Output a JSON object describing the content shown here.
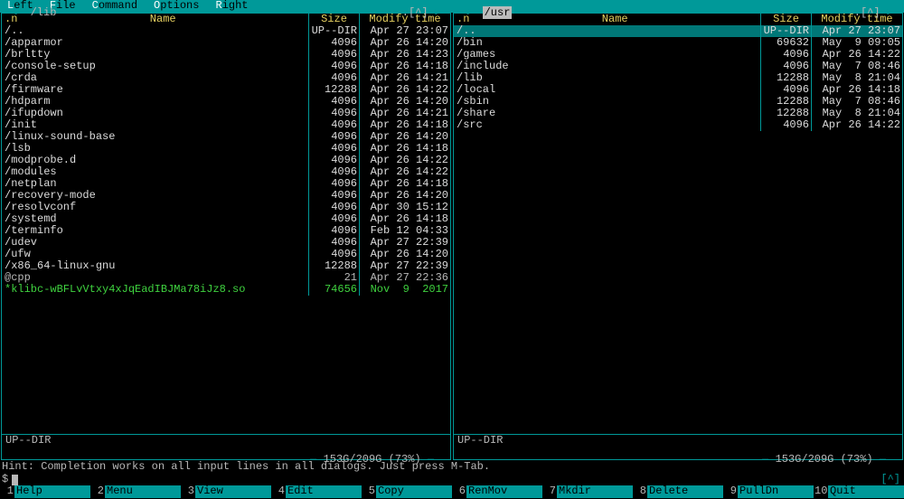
{
  "menu": {
    "items": [
      "Left",
      "File",
      "Command",
      "Options",
      "Right"
    ]
  },
  "panels": [
    {
      "path": "/lib",
      "active": false,
      "sort": ".[^]",
      "header": {
        "name": ".n",
        "name_label": "Name",
        "size": "Size",
        "mtime": "Modify time"
      },
      "status": "UP--DIR",
      "disk": "153G/209G (73%)",
      "rows": [
        {
          "name": "/..",
          "size": "UP--DIR",
          "mtime": "Apr 27 23:07",
          "cls": "dir"
        },
        {
          "name": "/apparmor",
          "size": "4096",
          "mtime": "Apr 26 14:20",
          "cls": "dir"
        },
        {
          "name": "/brltty",
          "size": "4096",
          "mtime": "Apr 26 14:23",
          "cls": "dir"
        },
        {
          "name": "/console-setup",
          "size": "4096",
          "mtime": "Apr 26 14:18",
          "cls": "dir"
        },
        {
          "name": "/crda",
          "size": "4096",
          "mtime": "Apr 26 14:21",
          "cls": "dir"
        },
        {
          "name": "/firmware",
          "size": "12288",
          "mtime": "Apr 26 14:22",
          "cls": "dir"
        },
        {
          "name": "/hdparm",
          "size": "4096",
          "mtime": "Apr 26 14:20",
          "cls": "dir"
        },
        {
          "name": "/ifupdown",
          "size": "4096",
          "mtime": "Apr 26 14:21",
          "cls": "dir"
        },
        {
          "name": "/init",
          "size": "4096",
          "mtime": "Apr 26 14:18",
          "cls": "dir"
        },
        {
          "name": "/linux-sound-base",
          "size": "4096",
          "mtime": "Apr 26 14:20",
          "cls": "dir"
        },
        {
          "name": "/lsb",
          "size": "4096",
          "mtime": "Apr 26 14:18",
          "cls": "dir"
        },
        {
          "name": "/modprobe.d",
          "size": "4096",
          "mtime": "Apr 26 14:22",
          "cls": "dir"
        },
        {
          "name": "/modules",
          "size": "4096",
          "mtime": "Apr 26 14:22",
          "cls": "dir"
        },
        {
          "name": "/netplan",
          "size": "4096",
          "mtime": "Apr 26 14:18",
          "cls": "dir"
        },
        {
          "name": "/recovery-mode",
          "size": "4096",
          "mtime": "Apr 26 14:20",
          "cls": "dir"
        },
        {
          "name": "/resolvconf",
          "size": "4096",
          "mtime": "Apr 30 15:12",
          "cls": "dir"
        },
        {
          "name": "/systemd",
          "size": "4096",
          "mtime": "Apr 26 14:18",
          "cls": "dir"
        },
        {
          "name": "/terminfo",
          "size": "4096",
          "mtime": "Feb 12 04:33",
          "cls": "dir"
        },
        {
          "name": "/udev",
          "size": "4096",
          "mtime": "Apr 27 22:39",
          "cls": "dir"
        },
        {
          "name": "/ufw",
          "size": "4096",
          "mtime": "Apr 26 14:20",
          "cls": "dir"
        },
        {
          "name": "/x86_64-linux-gnu",
          "size": "12288",
          "mtime": "Apr 27 22:39",
          "cls": "dir"
        },
        {
          "name": "@cpp",
          "size": "21",
          "mtime": "Apr 27 22:36",
          "cls": "link"
        },
        {
          "name": "*klibc-wBFLvVtxy4xJqEadIBJMa78iJz8.so",
          "size": "74656",
          "mtime": "Nov  9  2017",
          "cls": "special"
        }
      ]
    },
    {
      "path": "/usr",
      "active": true,
      "sort": ".[^]",
      "header": {
        "name": ".n",
        "name_label": "Name",
        "size": "Size",
        "mtime": "Modify time"
      },
      "status": "UP--DIR",
      "disk": "153G/209G (73%)",
      "rows": [
        {
          "name": "/..",
          "size": "UP--DIR",
          "mtime": "Apr 27 23:07",
          "cls": "dir selected"
        },
        {
          "name": "/bin",
          "size": "69632",
          "mtime": "May  9 09:05",
          "cls": "dir"
        },
        {
          "name": "/games",
          "size": "4096",
          "mtime": "Apr 26 14:22",
          "cls": "dir"
        },
        {
          "name": "/include",
          "size": "4096",
          "mtime": "May  7 08:46",
          "cls": "dir"
        },
        {
          "name": "/lib",
          "size": "12288",
          "mtime": "May  8 21:04",
          "cls": "dir"
        },
        {
          "name": "/local",
          "size": "4096",
          "mtime": "Apr 26 14:18",
          "cls": "dir"
        },
        {
          "name": "/sbin",
          "size": "12288",
          "mtime": "May  7 08:46",
          "cls": "dir"
        },
        {
          "name": "/share",
          "size": "12288",
          "mtime": "May  8 21:04",
          "cls": "dir"
        },
        {
          "name": "/src",
          "size": "4096",
          "mtime": "Apr 26 14:22",
          "cls": "dir"
        }
      ]
    }
  ],
  "hint": "Hint: Completion works on all input lines in all dialogs. Just press M-Tab.",
  "prompt": "$",
  "prompt_caret": "[^]",
  "fkeys": [
    {
      "n": "1",
      "l": "Help"
    },
    {
      "n": "2",
      "l": "Menu"
    },
    {
      "n": "3",
      "l": "View"
    },
    {
      "n": "4",
      "l": "Edit"
    },
    {
      "n": "5",
      "l": "Copy"
    },
    {
      "n": "6",
      "l": "RenMov"
    },
    {
      "n": "7",
      "l": "Mkdir"
    },
    {
      "n": "8",
      "l": "Delete"
    },
    {
      "n": "9",
      "l": "PullDn"
    },
    {
      "n": "10",
      "l": "Quit"
    }
  ]
}
